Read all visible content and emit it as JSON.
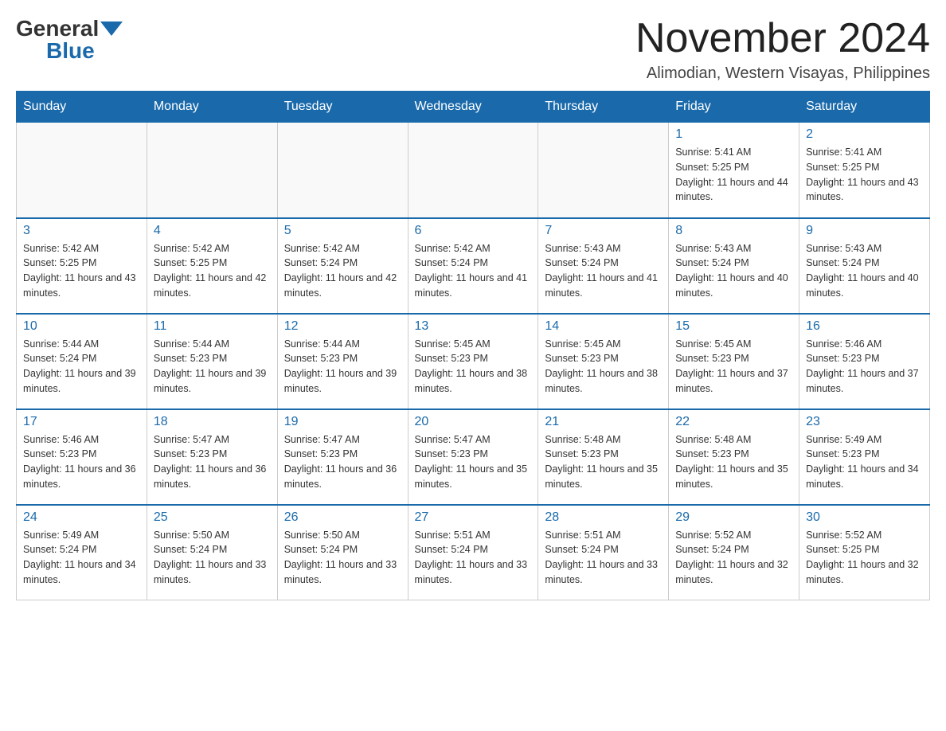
{
  "header": {
    "logo": {
      "general": "General",
      "blue": "Blue"
    },
    "title": "November 2024",
    "location": "Alimodian, Western Visayas, Philippines"
  },
  "weekdays": [
    "Sunday",
    "Monday",
    "Tuesday",
    "Wednesday",
    "Thursday",
    "Friday",
    "Saturday"
  ],
  "weeks": [
    [
      {
        "day": "",
        "sunrise": "",
        "sunset": "",
        "daylight": "",
        "empty": true
      },
      {
        "day": "",
        "sunrise": "",
        "sunset": "",
        "daylight": "",
        "empty": true
      },
      {
        "day": "",
        "sunrise": "",
        "sunset": "",
        "daylight": "",
        "empty": true
      },
      {
        "day": "",
        "sunrise": "",
        "sunset": "",
        "daylight": "",
        "empty": true
      },
      {
        "day": "",
        "sunrise": "",
        "sunset": "",
        "daylight": "",
        "empty": true
      },
      {
        "day": "1",
        "sunrise": "Sunrise: 5:41 AM",
        "sunset": "Sunset: 5:25 PM",
        "daylight": "Daylight: 11 hours and 44 minutes.",
        "empty": false
      },
      {
        "day": "2",
        "sunrise": "Sunrise: 5:41 AM",
        "sunset": "Sunset: 5:25 PM",
        "daylight": "Daylight: 11 hours and 43 minutes.",
        "empty": false
      }
    ],
    [
      {
        "day": "3",
        "sunrise": "Sunrise: 5:42 AM",
        "sunset": "Sunset: 5:25 PM",
        "daylight": "Daylight: 11 hours and 43 minutes.",
        "empty": false
      },
      {
        "day": "4",
        "sunrise": "Sunrise: 5:42 AM",
        "sunset": "Sunset: 5:25 PM",
        "daylight": "Daylight: 11 hours and 42 minutes.",
        "empty": false
      },
      {
        "day": "5",
        "sunrise": "Sunrise: 5:42 AM",
        "sunset": "Sunset: 5:24 PM",
        "daylight": "Daylight: 11 hours and 42 minutes.",
        "empty": false
      },
      {
        "day": "6",
        "sunrise": "Sunrise: 5:42 AM",
        "sunset": "Sunset: 5:24 PM",
        "daylight": "Daylight: 11 hours and 41 minutes.",
        "empty": false
      },
      {
        "day": "7",
        "sunrise": "Sunrise: 5:43 AM",
        "sunset": "Sunset: 5:24 PM",
        "daylight": "Daylight: 11 hours and 41 minutes.",
        "empty": false
      },
      {
        "day": "8",
        "sunrise": "Sunrise: 5:43 AM",
        "sunset": "Sunset: 5:24 PM",
        "daylight": "Daylight: 11 hours and 40 minutes.",
        "empty": false
      },
      {
        "day": "9",
        "sunrise": "Sunrise: 5:43 AM",
        "sunset": "Sunset: 5:24 PM",
        "daylight": "Daylight: 11 hours and 40 minutes.",
        "empty": false
      }
    ],
    [
      {
        "day": "10",
        "sunrise": "Sunrise: 5:44 AM",
        "sunset": "Sunset: 5:24 PM",
        "daylight": "Daylight: 11 hours and 39 minutes.",
        "empty": false
      },
      {
        "day": "11",
        "sunrise": "Sunrise: 5:44 AM",
        "sunset": "Sunset: 5:23 PM",
        "daylight": "Daylight: 11 hours and 39 minutes.",
        "empty": false
      },
      {
        "day": "12",
        "sunrise": "Sunrise: 5:44 AM",
        "sunset": "Sunset: 5:23 PM",
        "daylight": "Daylight: 11 hours and 39 minutes.",
        "empty": false
      },
      {
        "day": "13",
        "sunrise": "Sunrise: 5:45 AM",
        "sunset": "Sunset: 5:23 PM",
        "daylight": "Daylight: 11 hours and 38 minutes.",
        "empty": false
      },
      {
        "day": "14",
        "sunrise": "Sunrise: 5:45 AM",
        "sunset": "Sunset: 5:23 PM",
        "daylight": "Daylight: 11 hours and 38 minutes.",
        "empty": false
      },
      {
        "day": "15",
        "sunrise": "Sunrise: 5:45 AM",
        "sunset": "Sunset: 5:23 PM",
        "daylight": "Daylight: 11 hours and 37 minutes.",
        "empty": false
      },
      {
        "day": "16",
        "sunrise": "Sunrise: 5:46 AM",
        "sunset": "Sunset: 5:23 PM",
        "daylight": "Daylight: 11 hours and 37 minutes.",
        "empty": false
      }
    ],
    [
      {
        "day": "17",
        "sunrise": "Sunrise: 5:46 AM",
        "sunset": "Sunset: 5:23 PM",
        "daylight": "Daylight: 11 hours and 36 minutes.",
        "empty": false
      },
      {
        "day": "18",
        "sunrise": "Sunrise: 5:47 AM",
        "sunset": "Sunset: 5:23 PM",
        "daylight": "Daylight: 11 hours and 36 minutes.",
        "empty": false
      },
      {
        "day": "19",
        "sunrise": "Sunrise: 5:47 AM",
        "sunset": "Sunset: 5:23 PM",
        "daylight": "Daylight: 11 hours and 36 minutes.",
        "empty": false
      },
      {
        "day": "20",
        "sunrise": "Sunrise: 5:47 AM",
        "sunset": "Sunset: 5:23 PM",
        "daylight": "Daylight: 11 hours and 35 minutes.",
        "empty": false
      },
      {
        "day": "21",
        "sunrise": "Sunrise: 5:48 AM",
        "sunset": "Sunset: 5:23 PM",
        "daylight": "Daylight: 11 hours and 35 minutes.",
        "empty": false
      },
      {
        "day": "22",
        "sunrise": "Sunrise: 5:48 AM",
        "sunset": "Sunset: 5:23 PM",
        "daylight": "Daylight: 11 hours and 35 minutes.",
        "empty": false
      },
      {
        "day": "23",
        "sunrise": "Sunrise: 5:49 AM",
        "sunset": "Sunset: 5:23 PM",
        "daylight": "Daylight: 11 hours and 34 minutes.",
        "empty": false
      }
    ],
    [
      {
        "day": "24",
        "sunrise": "Sunrise: 5:49 AM",
        "sunset": "Sunset: 5:24 PM",
        "daylight": "Daylight: 11 hours and 34 minutes.",
        "empty": false
      },
      {
        "day": "25",
        "sunrise": "Sunrise: 5:50 AM",
        "sunset": "Sunset: 5:24 PM",
        "daylight": "Daylight: 11 hours and 33 minutes.",
        "empty": false
      },
      {
        "day": "26",
        "sunrise": "Sunrise: 5:50 AM",
        "sunset": "Sunset: 5:24 PM",
        "daylight": "Daylight: 11 hours and 33 minutes.",
        "empty": false
      },
      {
        "day": "27",
        "sunrise": "Sunrise: 5:51 AM",
        "sunset": "Sunset: 5:24 PM",
        "daylight": "Daylight: 11 hours and 33 minutes.",
        "empty": false
      },
      {
        "day": "28",
        "sunrise": "Sunrise: 5:51 AM",
        "sunset": "Sunset: 5:24 PM",
        "daylight": "Daylight: 11 hours and 33 minutes.",
        "empty": false
      },
      {
        "day": "29",
        "sunrise": "Sunrise: 5:52 AM",
        "sunset": "Sunset: 5:24 PM",
        "daylight": "Daylight: 11 hours and 32 minutes.",
        "empty": false
      },
      {
        "day": "30",
        "sunrise": "Sunrise: 5:52 AM",
        "sunset": "Sunset: 5:25 PM",
        "daylight": "Daylight: 11 hours and 32 minutes.",
        "empty": false
      }
    ]
  ]
}
